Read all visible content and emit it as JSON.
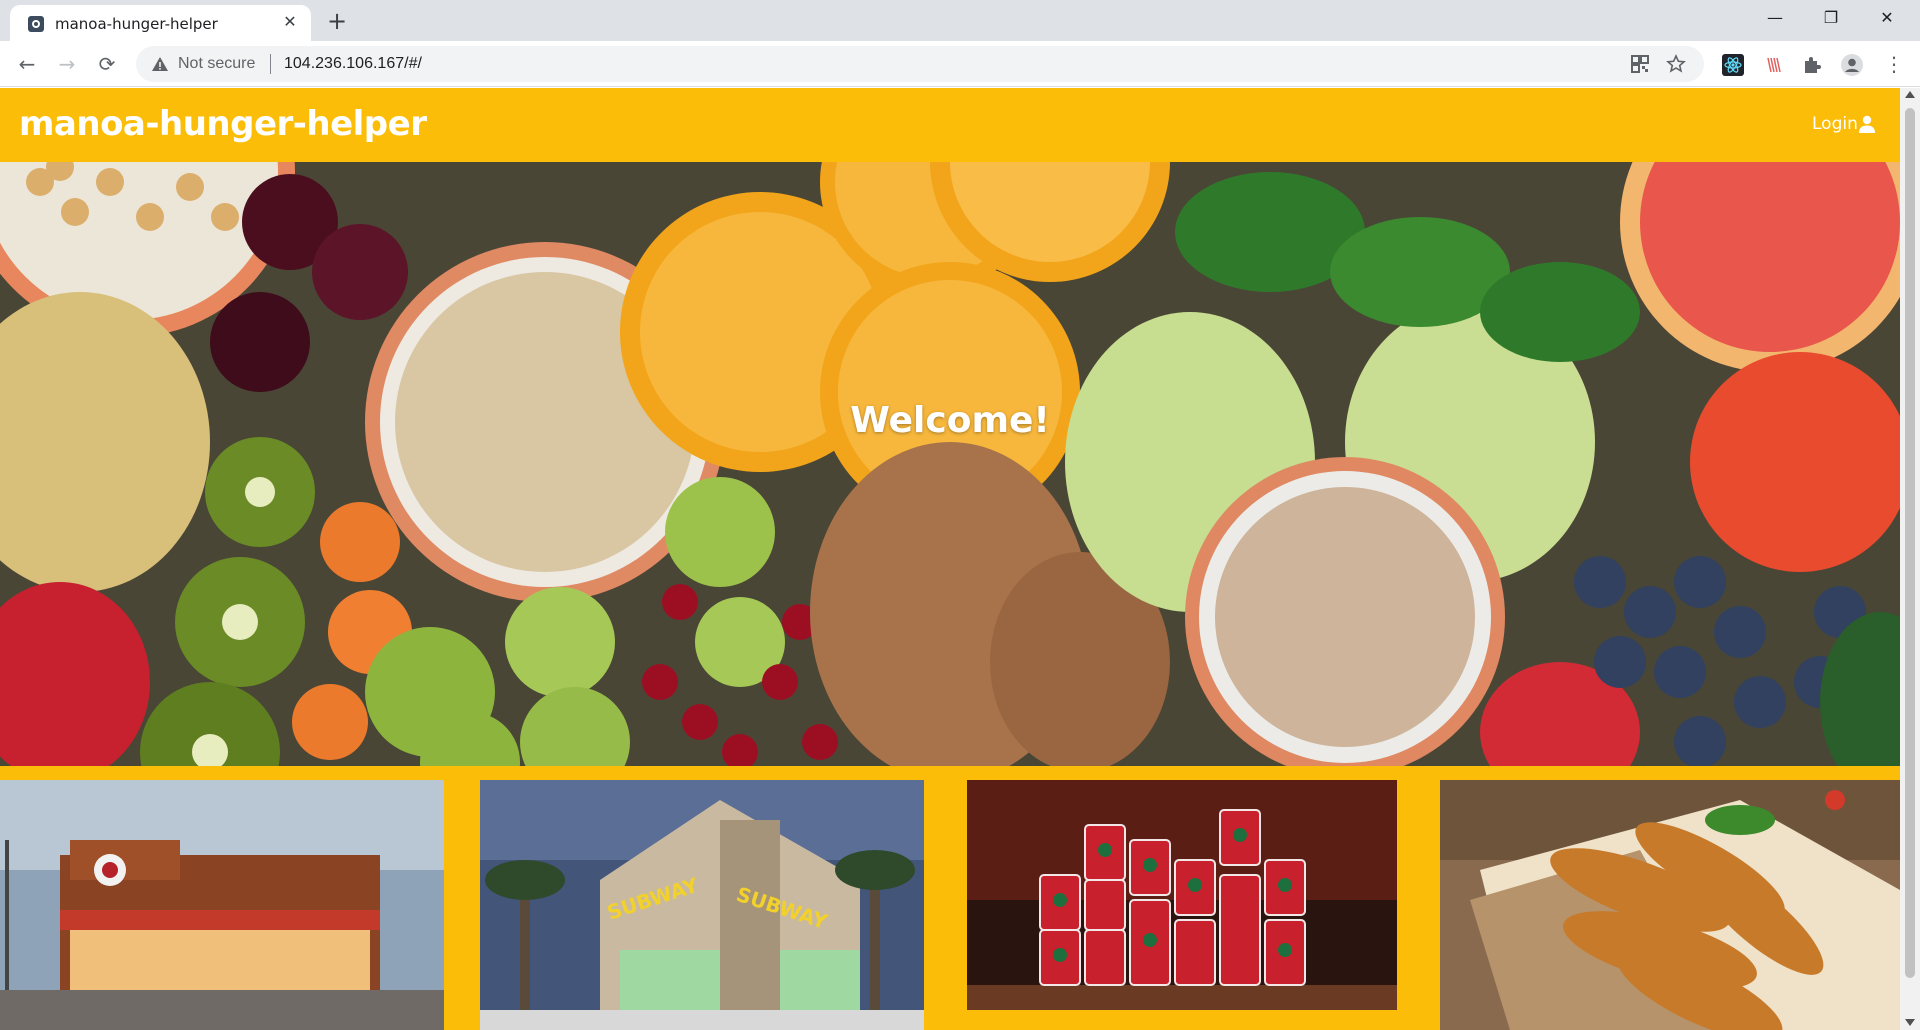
{
  "browser": {
    "tab_title": "manoa-hunger-helper",
    "tab_close": "✕",
    "new_tab": "+",
    "security_label": "Not secure",
    "url": "104.236.106.167/#/",
    "window_controls": {
      "minimize": "—",
      "restore": "❐",
      "close": "✕"
    },
    "nav": {
      "back": "←",
      "forward": "→",
      "reload": "⟳",
      "menu": "⋮"
    }
  },
  "navbar": {
    "brand": "manoa-hunger-helper",
    "login_label": "Login"
  },
  "hero": {
    "heading": "Welcome!"
  },
  "cards": [
    {
      "alt": "restaurant-exterior",
      "sign": ""
    },
    {
      "alt": "subway-store",
      "sign": "SUBWAY"
    },
    {
      "alt": "starbucks-holiday-cups",
      "sign": ""
    },
    {
      "alt": "chicken-tenders",
      "sign": ""
    }
  ],
  "colors": {
    "brand_yellow": "#fbbd07",
    "text_white": "#ffffff",
    "chrome_gray": "#dee1e6"
  }
}
